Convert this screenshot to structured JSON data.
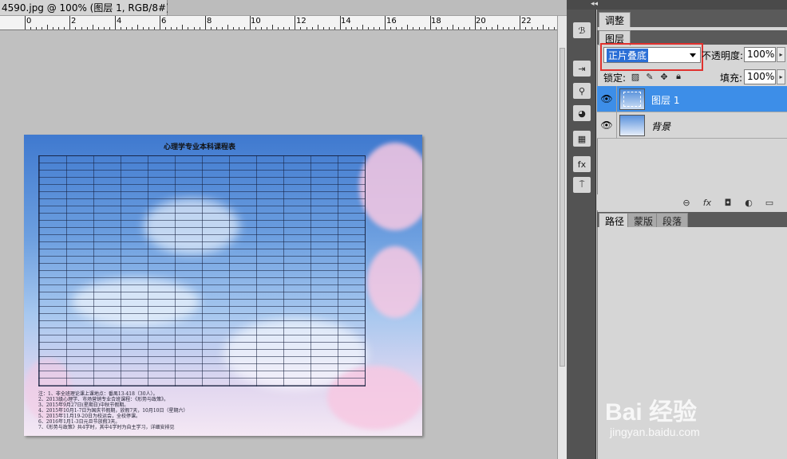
{
  "document": {
    "tab_title": "4590.jpg @ 100% (图层 1, RGB/8#) *",
    "ruler_numbers": [
      "0",
      "2",
      "4",
      "6",
      "8",
      "10",
      "12",
      "14",
      "16",
      "18",
      "20",
      "22"
    ],
    "schedule_title": "心理学专业本科课程表",
    "notes_line_1": "注：1、非全班理论课上课地点：番禺13-418（30人）。",
    "notes_line_2": "2、2013级心理学、市场营销专业合班课程：《形势与政策》。",
    "notes_line_3": "3、2015年9月27日(星期日)中秋节假期。",
    "notes_line_4": "4、2015年10月1-7日为国庆节假期，放假7天，10月10日（星期六）",
    "notes_line_5": "5、2015年11月19-20日为校运会，全校停课。",
    "notes_line_6": "6、2016年1月1-3日元旦节放假3天。",
    "notes_line_7": "7、《形势与政策》共4学时，其中4学时为自主学习，详细安排见"
  },
  "panels": {
    "adjustments_tab": "调整",
    "layers_tab": "图层",
    "blend_mode": "正片叠底",
    "opacity_label": "不透明度:",
    "opacity_value": "100%",
    "lock_label": "锁定:",
    "fill_label": "填充:",
    "fill_value": "100%",
    "layers": [
      {
        "name": "图层 1"
      },
      {
        "name": "背景"
      }
    ],
    "bottom_tabs": [
      "路径",
      "蒙版",
      "段落"
    ]
  },
  "watermark": {
    "main": "Bai 经验",
    "sub": "jingyan.baidu.com"
  },
  "colors": {
    "selection_blue": "#3d8ee8",
    "highlight_red": "#e0312e",
    "panel_gray": "#d6d6d6",
    "canvas_gray": "#c0c0c0"
  }
}
